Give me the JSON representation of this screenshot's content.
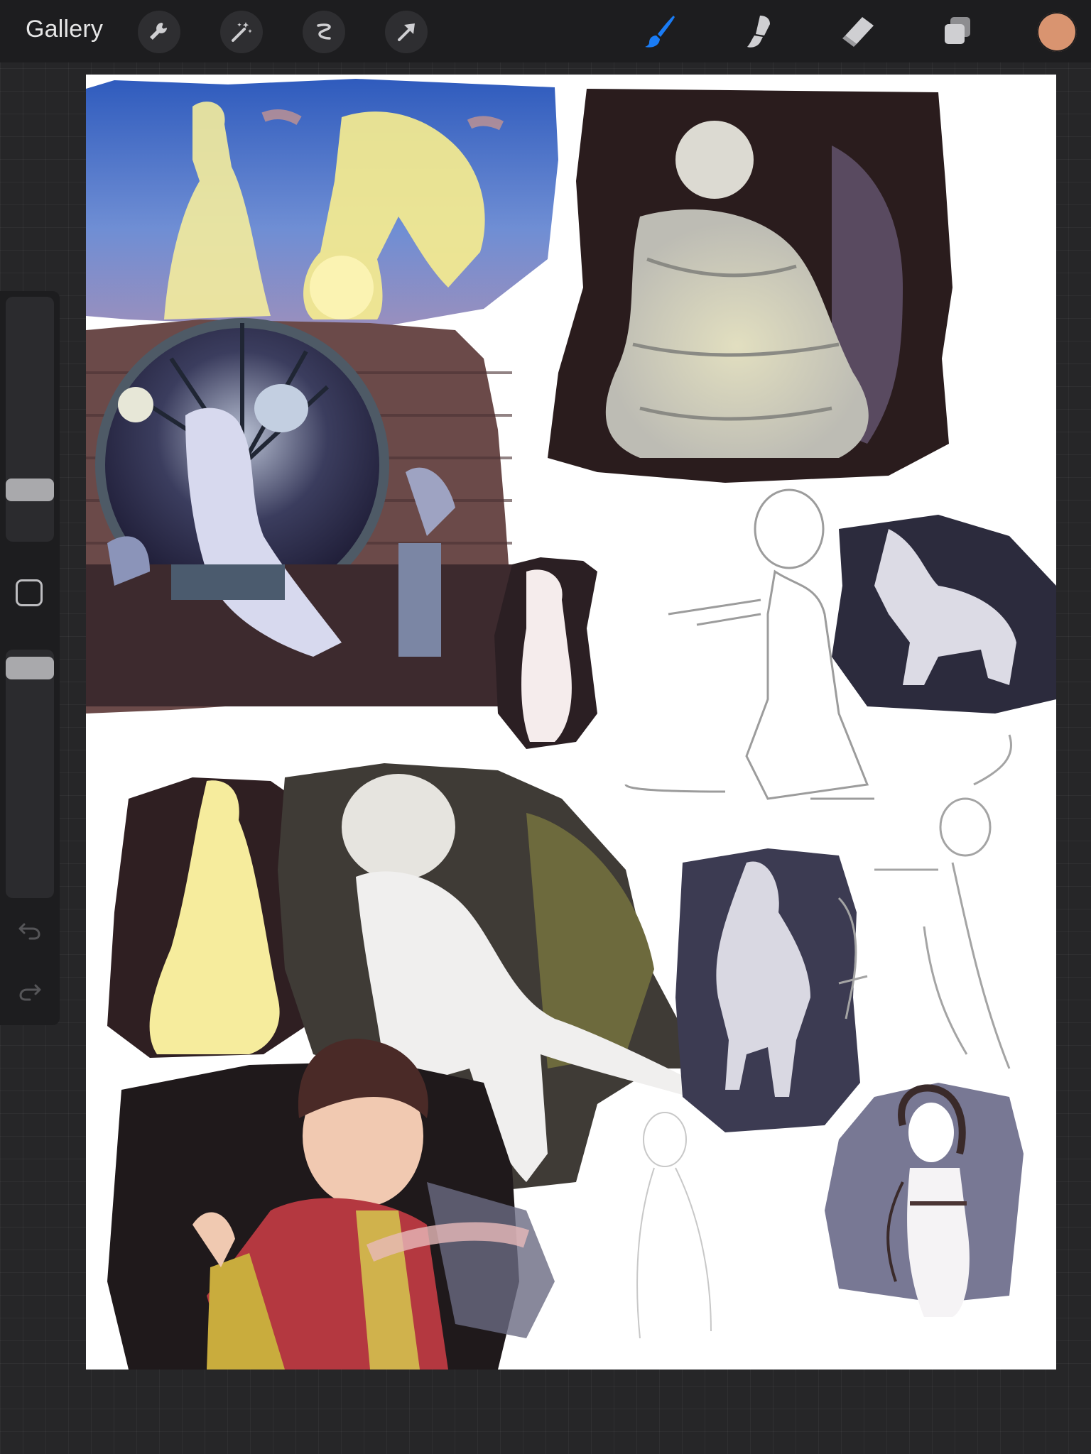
{
  "toolbar": {
    "gallery_label": "Gallery",
    "left_tools": [
      "wrench-icon",
      "magic-wand-icon",
      "selection-icon",
      "transform-arrow-icon"
    ],
    "right_tools": [
      "brush-icon",
      "smudge-icon",
      "eraser-icon",
      "layers-icon"
    ],
    "active_tool": "brush",
    "active_color": "#d99470",
    "accent_color": "#1a7cf5"
  },
  "sidebar": {
    "brush_size_level": 0.84,
    "opacity_level": 0.95
  }
}
